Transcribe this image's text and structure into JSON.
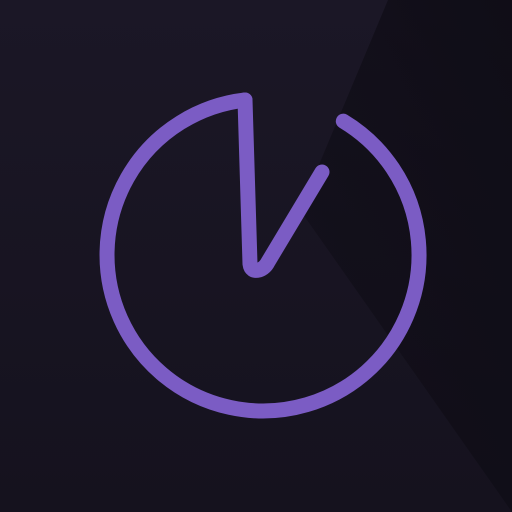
{
  "icon": {
    "name": "timer-logo-icon",
    "colors": {
      "background_top": "#1b1726",
      "background_bottom": "#15121e",
      "shadow": "#0c0a12",
      "stroke": "#7b5cc4"
    }
  }
}
